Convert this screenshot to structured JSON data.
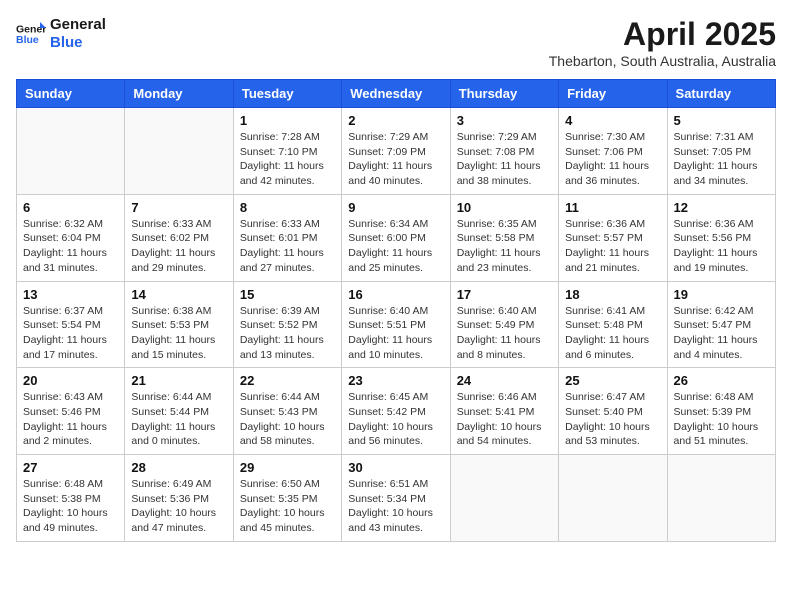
{
  "header": {
    "logo_line1": "General",
    "logo_line2": "Blue",
    "month": "April 2025",
    "location": "Thebarton, South Australia, Australia"
  },
  "weekdays": [
    "Sunday",
    "Monday",
    "Tuesday",
    "Wednesday",
    "Thursday",
    "Friday",
    "Saturday"
  ],
  "weeks": [
    [
      {
        "day": "",
        "info": ""
      },
      {
        "day": "",
        "info": ""
      },
      {
        "day": "1",
        "info": "Sunrise: 7:28 AM\nSunset: 7:10 PM\nDaylight: 11 hours and 42 minutes."
      },
      {
        "day": "2",
        "info": "Sunrise: 7:29 AM\nSunset: 7:09 PM\nDaylight: 11 hours and 40 minutes."
      },
      {
        "day": "3",
        "info": "Sunrise: 7:29 AM\nSunset: 7:08 PM\nDaylight: 11 hours and 38 minutes."
      },
      {
        "day": "4",
        "info": "Sunrise: 7:30 AM\nSunset: 7:06 PM\nDaylight: 11 hours and 36 minutes."
      },
      {
        "day": "5",
        "info": "Sunrise: 7:31 AM\nSunset: 7:05 PM\nDaylight: 11 hours and 34 minutes."
      }
    ],
    [
      {
        "day": "6",
        "info": "Sunrise: 6:32 AM\nSunset: 6:04 PM\nDaylight: 11 hours and 31 minutes."
      },
      {
        "day": "7",
        "info": "Sunrise: 6:33 AM\nSunset: 6:02 PM\nDaylight: 11 hours and 29 minutes."
      },
      {
        "day": "8",
        "info": "Sunrise: 6:33 AM\nSunset: 6:01 PM\nDaylight: 11 hours and 27 minutes."
      },
      {
        "day": "9",
        "info": "Sunrise: 6:34 AM\nSunset: 6:00 PM\nDaylight: 11 hours and 25 minutes."
      },
      {
        "day": "10",
        "info": "Sunrise: 6:35 AM\nSunset: 5:58 PM\nDaylight: 11 hours and 23 minutes."
      },
      {
        "day": "11",
        "info": "Sunrise: 6:36 AM\nSunset: 5:57 PM\nDaylight: 11 hours and 21 minutes."
      },
      {
        "day": "12",
        "info": "Sunrise: 6:36 AM\nSunset: 5:56 PM\nDaylight: 11 hours and 19 minutes."
      }
    ],
    [
      {
        "day": "13",
        "info": "Sunrise: 6:37 AM\nSunset: 5:54 PM\nDaylight: 11 hours and 17 minutes."
      },
      {
        "day": "14",
        "info": "Sunrise: 6:38 AM\nSunset: 5:53 PM\nDaylight: 11 hours and 15 minutes."
      },
      {
        "day": "15",
        "info": "Sunrise: 6:39 AM\nSunset: 5:52 PM\nDaylight: 11 hours and 13 minutes."
      },
      {
        "day": "16",
        "info": "Sunrise: 6:40 AM\nSunset: 5:51 PM\nDaylight: 11 hours and 10 minutes."
      },
      {
        "day": "17",
        "info": "Sunrise: 6:40 AM\nSunset: 5:49 PM\nDaylight: 11 hours and 8 minutes."
      },
      {
        "day": "18",
        "info": "Sunrise: 6:41 AM\nSunset: 5:48 PM\nDaylight: 11 hours and 6 minutes."
      },
      {
        "day": "19",
        "info": "Sunrise: 6:42 AM\nSunset: 5:47 PM\nDaylight: 11 hours and 4 minutes."
      }
    ],
    [
      {
        "day": "20",
        "info": "Sunrise: 6:43 AM\nSunset: 5:46 PM\nDaylight: 11 hours and 2 minutes."
      },
      {
        "day": "21",
        "info": "Sunrise: 6:44 AM\nSunset: 5:44 PM\nDaylight: 11 hours and 0 minutes."
      },
      {
        "day": "22",
        "info": "Sunrise: 6:44 AM\nSunset: 5:43 PM\nDaylight: 10 hours and 58 minutes."
      },
      {
        "day": "23",
        "info": "Sunrise: 6:45 AM\nSunset: 5:42 PM\nDaylight: 10 hours and 56 minutes."
      },
      {
        "day": "24",
        "info": "Sunrise: 6:46 AM\nSunset: 5:41 PM\nDaylight: 10 hours and 54 minutes."
      },
      {
        "day": "25",
        "info": "Sunrise: 6:47 AM\nSunset: 5:40 PM\nDaylight: 10 hours and 53 minutes."
      },
      {
        "day": "26",
        "info": "Sunrise: 6:48 AM\nSunset: 5:39 PM\nDaylight: 10 hours and 51 minutes."
      }
    ],
    [
      {
        "day": "27",
        "info": "Sunrise: 6:48 AM\nSunset: 5:38 PM\nDaylight: 10 hours and 49 minutes."
      },
      {
        "day": "28",
        "info": "Sunrise: 6:49 AM\nSunset: 5:36 PM\nDaylight: 10 hours and 47 minutes."
      },
      {
        "day": "29",
        "info": "Sunrise: 6:50 AM\nSunset: 5:35 PM\nDaylight: 10 hours and 45 minutes."
      },
      {
        "day": "30",
        "info": "Sunrise: 6:51 AM\nSunset: 5:34 PM\nDaylight: 10 hours and 43 minutes."
      },
      {
        "day": "",
        "info": ""
      },
      {
        "day": "",
        "info": ""
      },
      {
        "day": "",
        "info": ""
      }
    ]
  ]
}
